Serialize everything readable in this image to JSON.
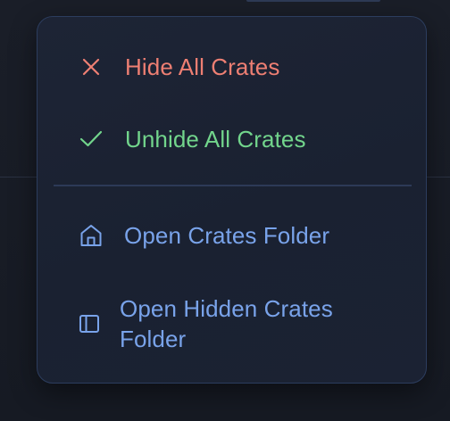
{
  "menu": {
    "items": [
      {
        "label": "Hide All Crates",
        "icon": "close-icon",
        "color": "#ee7f73"
      },
      {
        "label": "Unhide All Crates",
        "icon": "check-icon",
        "color": "#72d58c"
      },
      {
        "label": "Open Crates Folder",
        "icon": "home-icon",
        "color": "#79a3ea"
      },
      {
        "label": "Open Hidden Crates Folder",
        "icon": "sidebar-panel-icon",
        "color": "#79a3ea"
      }
    ]
  },
  "colors": {
    "background": "#181c25",
    "menu_background": "#1d2435",
    "menu_border": "#2c3d5e",
    "divider": "#2d3a57"
  }
}
